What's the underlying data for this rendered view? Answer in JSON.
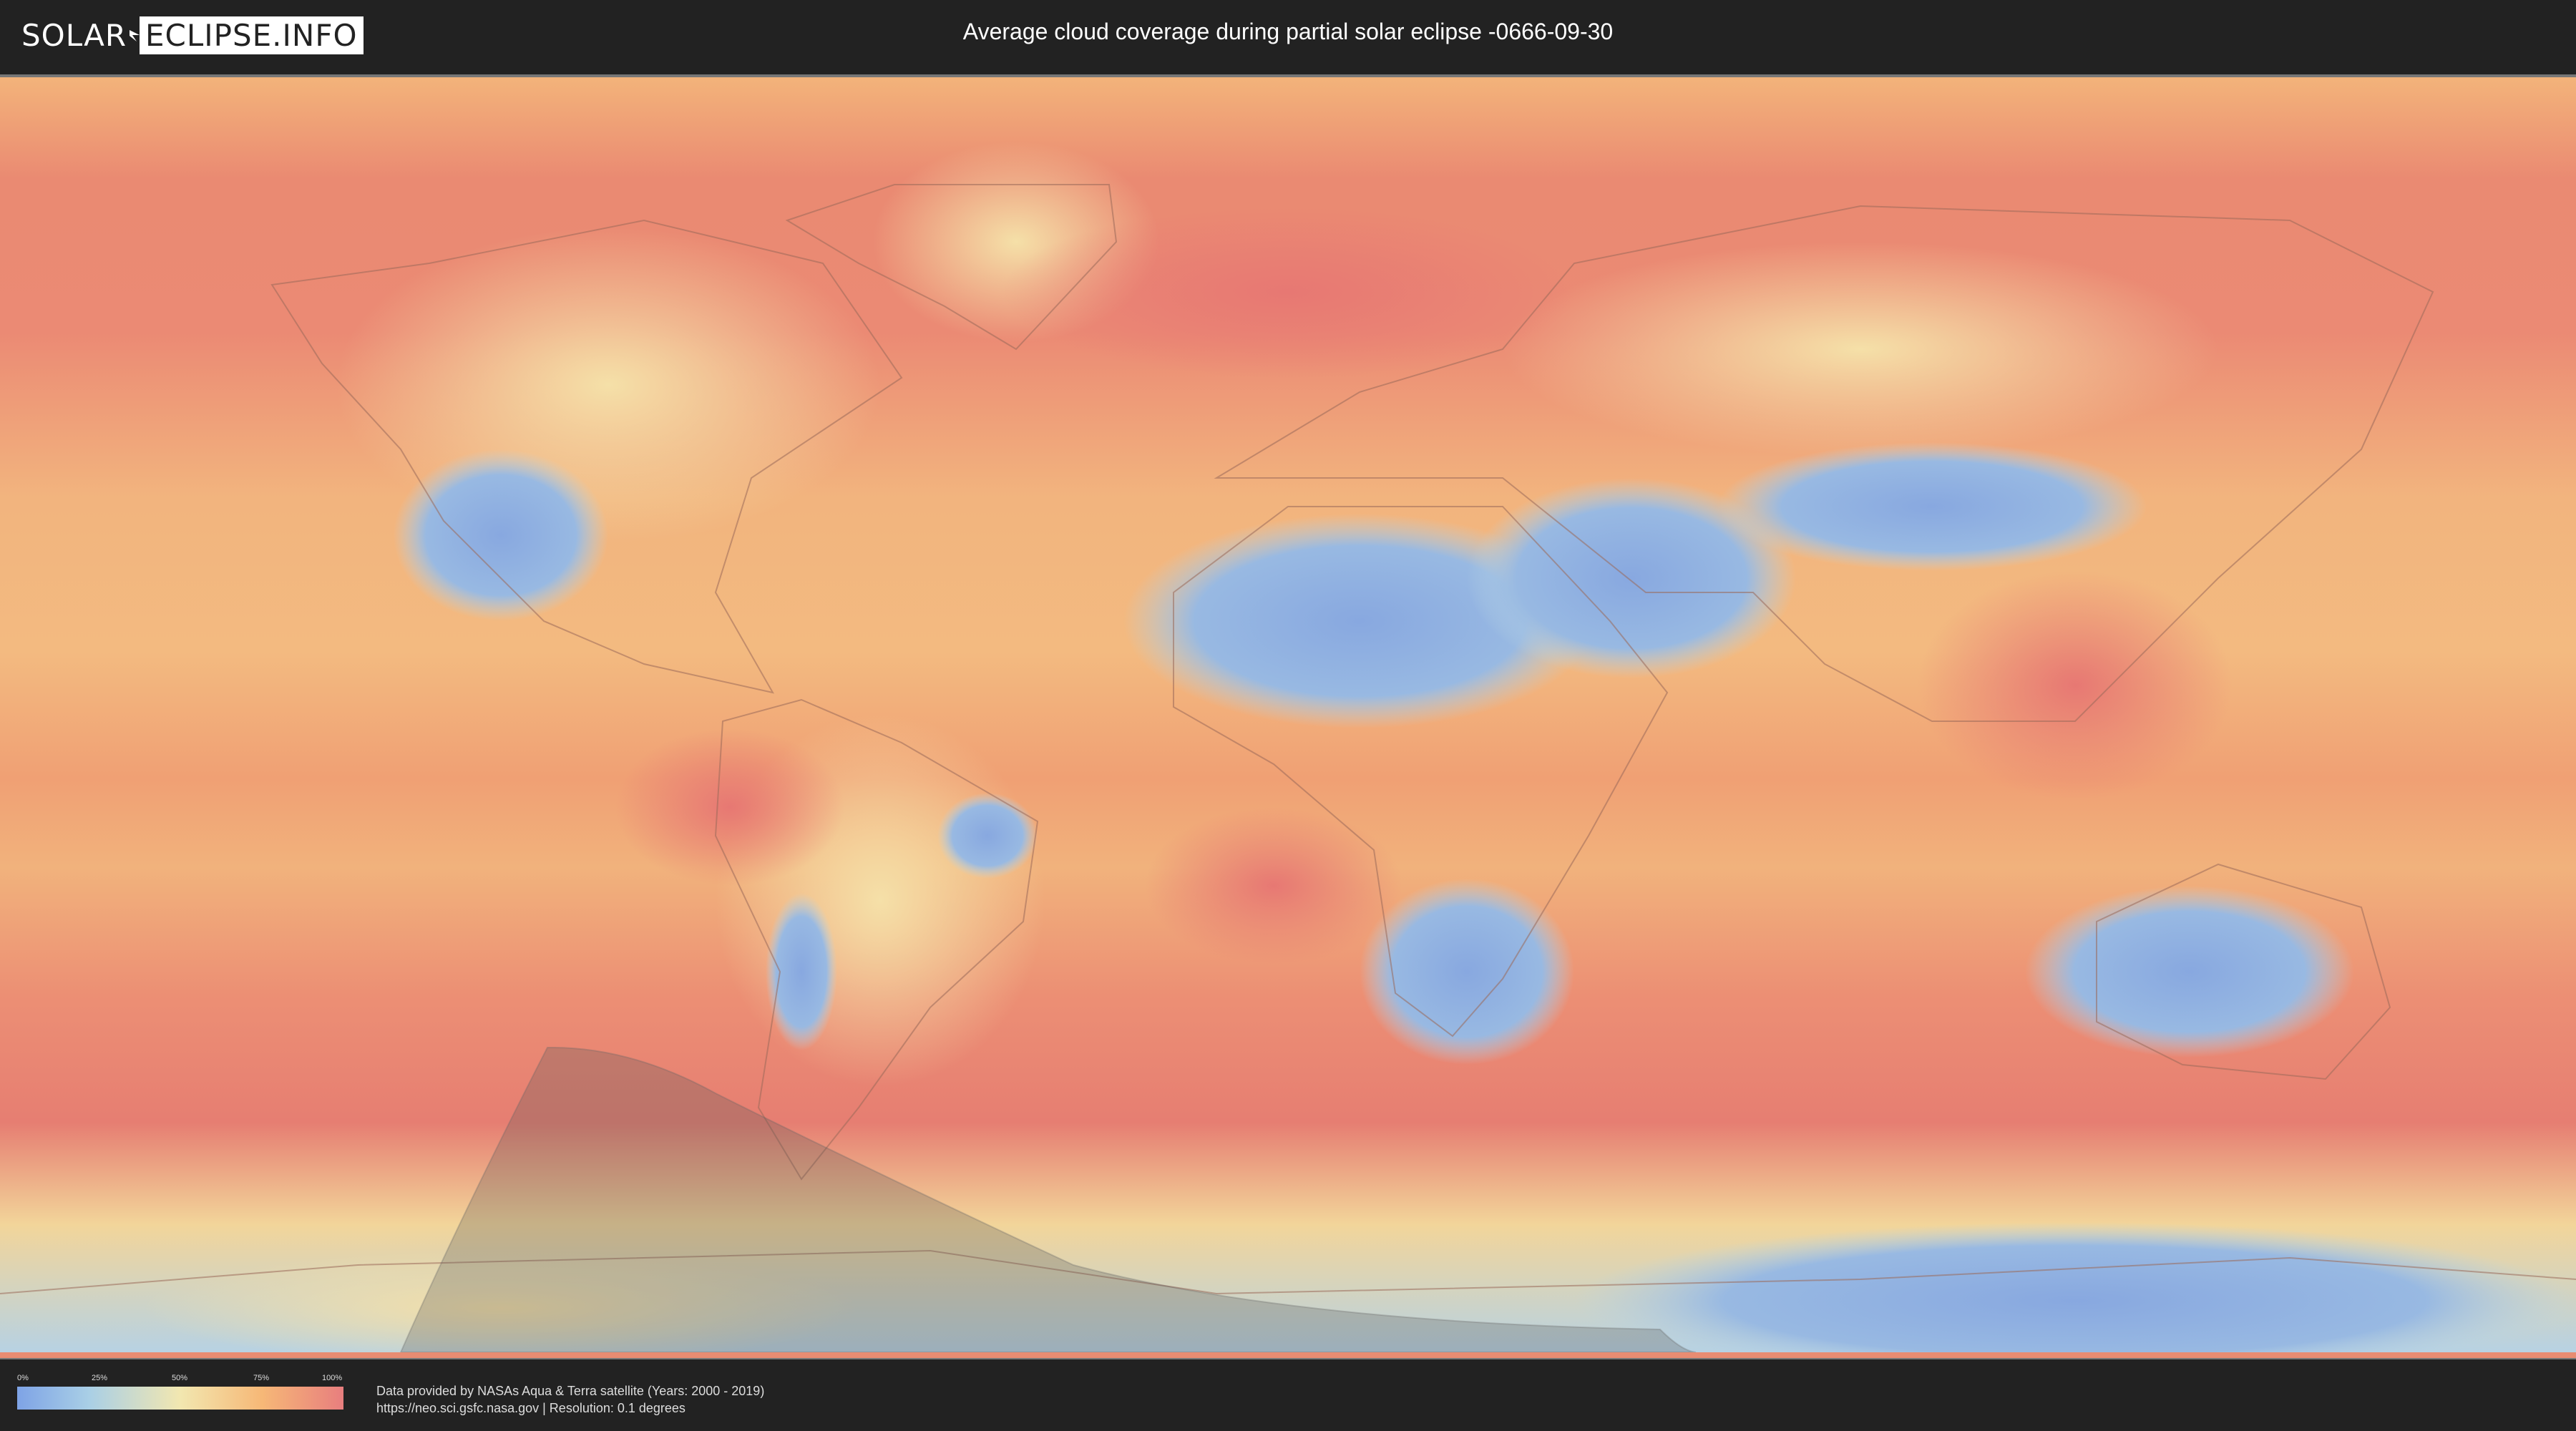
{
  "header": {
    "logo_left": "SOLAR",
    "logo_right": "ECLIPSE.INFO",
    "title": "Average cloud coverage during partial solar eclipse -0666-09-30"
  },
  "legend": {
    "ticks": [
      "0%",
      "25%",
      "50%",
      "75%",
      "100%"
    ],
    "colors": [
      "#7ea3e6",
      "#a9cfe6",
      "#f2e7b0",
      "#f6b877",
      "#e87e7e"
    ]
  },
  "credits": {
    "line1": "Data provided by NASAs Aqua & Terra satellite (Years: 2000 - 2019)",
    "line2": "https://neo.sci.gsfc.nasa.gov | Resolution: 0.1 degrees"
  }
}
